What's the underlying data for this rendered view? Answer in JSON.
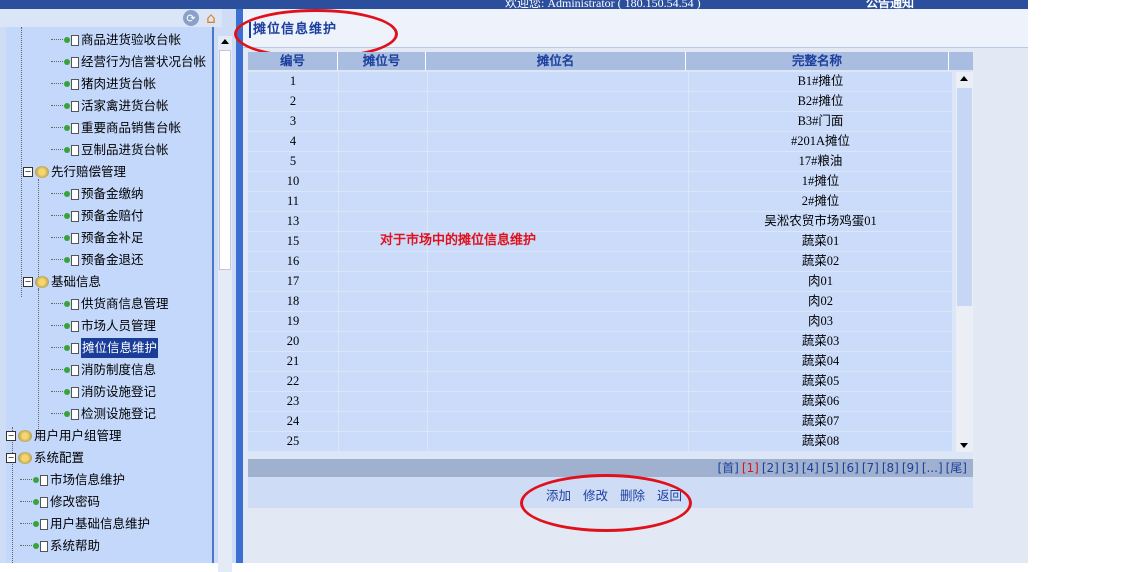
{
  "topbar": {
    "welcome": "欢迎您: Administrator ( 180.150.54.54 )",
    "notice": "公告通知"
  },
  "icons": {
    "refresh": "refresh-icon",
    "home": "home-icon"
  },
  "tree": {
    "items": [
      {
        "label": "商品进货验收台帐",
        "type": "leaf"
      },
      {
        "label": "经营行为信誉状况台帐",
        "type": "leaf"
      },
      {
        "label": "猪肉进货台帐",
        "type": "leaf"
      },
      {
        "label": "活家禽进货台帐",
        "type": "leaf"
      },
      {
        "label": "重要商品销售台帐",
        "type": "leaf"
      },
      {
        "label": "豆制品进货台帐",
        "type": "leaf"
      },
      {
        "label": "先行赔偿管理",
        "type": "folder"
      },
      {
        "label": "预备金缴纳",
        "type": "leaf"
      },
      {
        "label": "预备金赔付",
        "type": "leaf"
      },
      {
        "label": "预备金补足",
        "type": "leaf"
      },
      {
        "label": "预备金退还",
        "type": "leaf"
      },
      {
        "label": "基础信息",
        "type": "folder"
      },
      {
        "label": "供货商信息管理",
        "type": "leaf"
      },
      {
        "label": "市场人员管理",
        "type": "leaf"
      },
      {
        "label": "摊位信息维护",
        "type": "leaf",
        "selected": true
      },
      {
        "label": "消防制度信息",
        "type": "leaf"
      },
      {
        "label": "消防设施登记",
        "type": "leaf"
      },
      {
        "label": "检测设施登记",
        "type": "leaf"
      },
      {
        "label": "用户用户组管理",
        "type": "folder"
      },
      {
        "label": "系统配置",
        "type": "folder"
      },
      {
        "label": "市场信息维护",
        "type": "leaf"
      },
      {
        "label": "修改密码",
        "type": "leaf"
      },
      {
        "label": "用户基础信息维护",
        "type": "leaf"
      },
      {
        "label": "系统帮助",
        "type": "leaf"
      }
    ]
  },
  "main": {
    "title": "摊位信息维护",
    "annotation": "对于市场中的摊位信息维护",
    "columns": [
      "编号",
      "摊位号",
      "摊位名",
      "完整名称"
    ],
    "rows": [
      [
        "1",
        "",
        "",
        "B1#摊位"
      ],
      [
        "2",
        "",
        "",
        "B2#摊位"
      ],
      [
        "3",
        "",
        "",
        "B3#门面"
      ],
      [
        "4",
        "",
        "",
        "#201A摊位"
      ],
      [
        "5",
        "",
        "",
        "17#粮油"
      ],
      [
        "10",
        "",
        "",
        "1#摊位"
      ],
      [
        "11",
        "",
        "",
        "2#摊位"
      ],
      [
        "13",
        "",
        "",
        "吴淞农贸市场鸡蛋01"
      ],
      [
        "15",
        "",
        "",
        "蔬菜01"
      ],
      [
        "16",
        "",
        "",
        "蔬菜02"
      ],
      [
        "17",
        "",
        "",
        "肉01"
      ],
      [
        "18",
        "",
        "",
        "肉02"
      ],
      [
        "19",
        "",
        "",
        "肉03"
      ],
      [
        "20",
        "",
        "",
        "蔬菜03"
      ],
      [
        "21",
        "",
        "",
        "蔬菜04"
      ],
      [
        "22",
        "",
        "",
        "蔬菜05"
      ],
      [
        "23",
        "",
        "",
        "蔬菜06"
      ],
      [
        "24",
        "",
        "",
        "蔬菜07"
      ],
      [
        "25",
        "",
        "",
        "蔬菜08"
      ]
    ],
    "pager": [
      "[首]",
      "[1]",
      "[2]",
      "[3]",
      "[4]",
      "[5]",
      "[6]",
      "[7]",
      "[8]",
      "[9]",
      "[...]",
      "[尾]"
    ],
    "pager_current": "[1]",
    "actions": [
      "添加",
      "修改",
      "删除",
      "返回"
    ]
  },
  "colors": {
    "accent": "#1c3f9e",
    "annotation": "#e0111b",
    "row_bg": "#cbdcfb",
    "header_bg": "#a9bde0"
  }
}
